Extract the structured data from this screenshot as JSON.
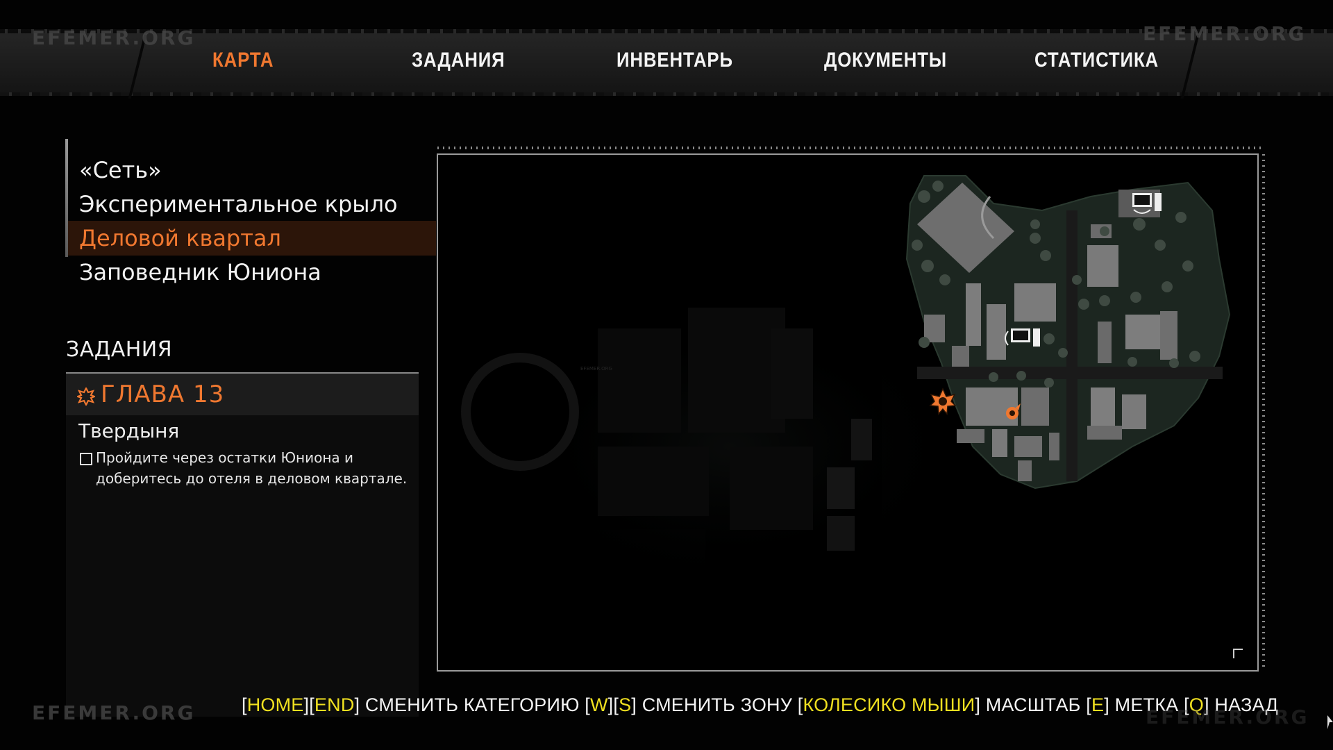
{
  "watermarks": [
    "EFEMER.ORG",
    "EFEMER.ORG",
    "EFEMER.ORG",
    "EFEMER.ORG"
  ],
  "tabs": [
    {
      "label": "КАРТА",
      "active": true
    },
    {
      "label": "ЗАДАНИЯ",
      "active": false
    },
    {
      "label": "ИНВЕНТАРЬ",
      "active": false
    },
    {
      "label": "ДОКУМЕНТЫ",
      "active": false
    },
    {
      "label": "СТАТИСТИКА",
      "active": false
    }
  ],
  "zones": [
    {
      "label": "«Сеть»",
      "selected": false
    },
    {
      "label": "Экспериментальное крыло",
      "selected": false
    },
    {
      "label": "Деловой квартал",
      "selected": true
    },
    {
      "label": "Заповедник Юниона",
      "selected": false
    }
  ],
  "quests": {
    "title": "ЗАДАНИЯ",
    "chapter": "ГЛАВА 13",
    "name": "Твердыня",
    "objective": "Пройдите через остатки Юниона и доберитесь до отеля в деловом квартале.",
    "objective_done": false
  },
  "map": {
    "watermark": "EFEMER.ORG",
    "markers": [
      {
        "name": "computer-terminal-icon"
      },
      {
        "name": "computer-terminal-icon"
      },
      {
        "name": "chapter-objective-icon"
      },
      {
        "name": "player-location-icon"
      }
    ],
    "colors": {
      "accent": "#f07830",
      "buildings": "#7a7a7a",
      "grass": "#1e2a22",
      "roads": "#1a1a1a"
    }
  },
  "hints": [
    {
      "key": "HOME",
      "text": ""
    },
    {
      "key": "END",
      "text": " СМЕНИТЬ КАТЕГОРИЮ "
    },
    {
      "key": "W",
      "text": ""
    },
    {
      "key": "S",
      "text": " СМЕНИТЬ ЗОНУ "
    },
    {
      "key": "КОЛЕСИКО МЫШИ",
      "text": " МАСШТАБ "
    },
    {
      "key": "E",
      "text": " МЕТКА "
    },
    {
      "key": "Q",
      "text": " НАЗАД"
    }
  ],
  "colors": {
    "accent": "#f07830",
    "key_highlight": "#f0e020",
    "text": "#f2f2f2"
  }
}
